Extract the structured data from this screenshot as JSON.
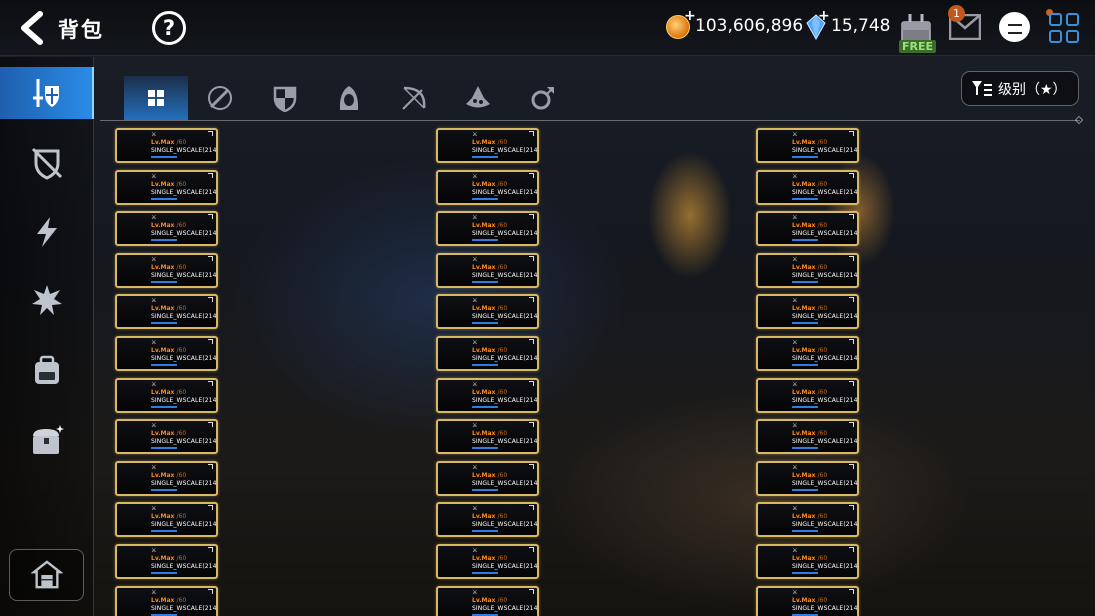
{
  "header": {
    "title": "背包",
    "help_icon": "question-circle-icon",
    "gold": "103,606,896",
    "crystal": "15,748",
    "free_label": "FREE",
    "mail_badge": "1"
  },
  "sidebar": {
    "items": [
      {
        "icon": "sword-shield-icon",
        "active": true
      },
      {
        "icon": "broken-shield-icon",
        "active": false
      },
      {
        "icon": "lightning-icon",
        "active": false
      },
      {
        "icon": "burst-icon",
        "active": false
      },
      {
        "icon": "backpack-icon",
        "active": false
      },
      {
        "icon": "treasure-chest-icon",
        "active": false
      }
    ],
    "bottom_icon": "house-icon"
  },
  "tabs": {
    "items": [
      {
        "icon": "grid-icon",
        "active": true
      },
      {
        "icon": "sword-icon",
        "active": false
      },
      {
        "icon": "shield-icon",
        "active": false
      },
      {
        "icon": "hood-icon",
        "active": false
      },
      {
        "icon": "bow-icon",
        "active": false
      },
      {
        "icon": "potion-icon",
        "active": false
      },
      {
        "icon": "ring-icon",
        "active": false
      }
    ],
    "sort_label": "级别（★）"
  },
  "items": {
    "level_text": "Lv.Max",
    "level_suffix": "/60",
    "name_text": "SINGLE_WSCALE(214)",
    "count": 36
  },
  "colors": {
    "accent_blue": "#2a8ce8",
    "card_border": "#d8b860",
    "level_orange": "#ff8a1a"
  }
}
